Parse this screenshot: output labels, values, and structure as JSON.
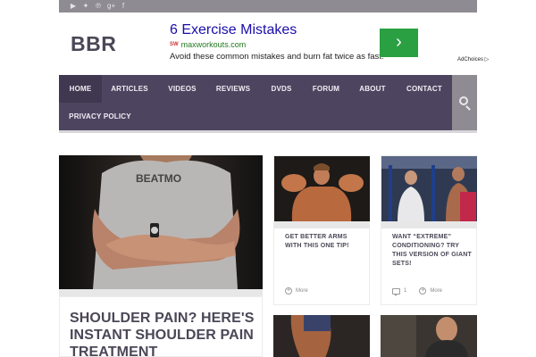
{
  "topbar": {
    "social_icons": [
      "youtube-icon",
      "twitter-icon",
      "pinterest-icon",
      "google-plus-icon",
      "facebook-icon"
    ],
    "social_glyphs": [
      "▶",
      "✦",
      "℗",
      "g+",
      "f"
    ]
  },
  "site": {
    "logo": "BBR"
  },
  "ad": {
    "title": "6 Exercise Mistakes",
    "url": "maxworkouts.com",
    "url_flag": "SW",
    "description": "Avoid these common mistakes and burn fat twice as fast!",
    "arrow": "›",
    "adchoices": "AdChoices ▷"
  },
  "nav": {
    "items": [
      "HOME",
      "ARTICLES",
      "VIDEOS",
      "REVIEWS",
      "DVDS",
      "FORUM",
      "ABOUT",
      "CONTACT",
      "PRIVACY POLICY"
    ],
    "active": "HOME"
  },
  "featured": {
    "title": "SHOULDER PAIN? HERE'S INSTANT SHOULDER PAIN TREATMENT"
  },
  "cards": [
    {
      "title": "GET BETTER ARMS WITH THIS ONE TIP!",
      "comments": "",
      "more": "More"
    },
    {
      "title": "WANT “EXTREME” CONDITIONING? TRY THIS VERSION OF GIANT SETS!",
      "comments": "1",
      "more": "More"
    }
  ],
  "colors": {
    "nav_bg": "#4d4560",
    "topbar_bg": "#8f8b92",
    "ad_green": "#2aa043",
    "ad_link": "#1a0dab",
    "heading": "#4b4757"
  }
}
